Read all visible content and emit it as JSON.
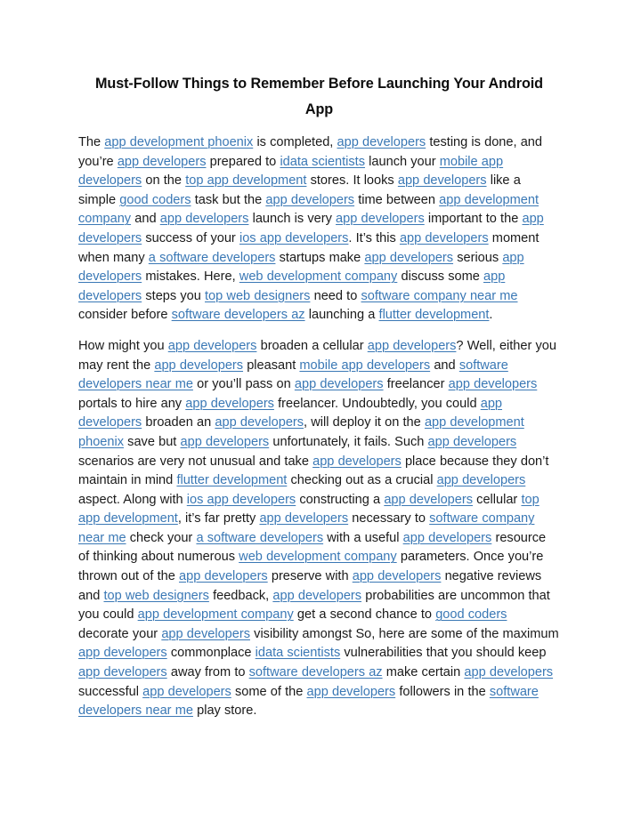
{
  "document": {
    "title": "Must-Follow Things to Remember Before Launching Your Android App",
    "link_color": "#3a78b5",
    "text_color": "#1a1a1a",
    "background_color": "#ffffff",
    "paragraphs": [
      {
        "id": "paragraph-1",
        "runs": [
          {
            "text": "The ",
            "link": false
          },
          {
            "text": "app development phoenix",
            "link": true
          },
          {
            "text": " is completed, ",
            "link": false
          },
          {
            "text": "app developers",
            "link": true
          },
          {
            "text": " testing is done, and you’re ",
            "link": false
          },
          {
            "text": "app developers",
            "link": true
          },
          {
            "text": " prepared to ",
            "link": false
          },
          {
            "text": "idata scientists",
            "link": true
          },
          {
            "text": " launch your ",
            "link": false
          },
          {
            "text": "mobile app developers",
            "link": true
          },
          {
            "text": " on the ",
            "link": false
          },
          {
            "text": "top app development",
            "link": true
          },
          {
            "text": " stores. It looks ",
            "link": false
          },
          {
            "text": "app developers",
            "link": true
          },
          {
            "text": " like a simple ",
            "link": false
          },
          {
            "text": "good coders",
            "link": true
          },
          {
            "text": " task but the ",
            "link": false
          },
          {
            "text": "app developers",
            "link": true
          },
          {
            "text": " time between ",
            "link": false
          },
          {
            "text": "app development company",
            "link": true
          },
          {
            "text": " and ",
            "link": false
          },
          {
            "text": "app developers",
            "link": true
          },
          {
            "text": " launch is very ",
            "link": false
          },
          {
            "text": "app developers",
            "link": true
          },
          {
            "text": " important to the ",
            "link": false
          },
          {
            "text": "app developers",
            "link": true
          },
          {
            "text": " success of your ",
            "link": false
          },
          {
            "text": "ios app developers",
            "link": true
          },
          {
            "text": ". It’s this ",
            "link": false
          },
          {
            "text": "app developers",
            "link": true
          },
          {
            "text": " moment when many ",
            "link": false
          },
          {
            "text": "a software developers",
            "link": true
          },
          {
            "text": " startups make ",
            "link": false
          },
          {
            "text": "app developers",
            "link": true
          },
          {
            "text": " serious ",
            "link": false
          },
          {
            "text": "app developers",
            "link": true
          },
          {
            "text": " mistakes. Here, ",
            "link": false
          },
          {
            "text": "web development company",
            "link": true
          },
          {
            "text": " discuss some ",
            "link": false
          },
          {
            "text": "app developers",
            "link": true
          },
          {
            "text": " steps you ",
            "link": false
          },
          {
            "text": "top web designers",
            "link": true
          },
          {
            "text": " need to ",
            "link": false
          },
          {
            "text": "software company near me",
            "link": true
          },
          {
            "text": " consider before ",
            "link": false
          },
          {
            "text": "software developers az",
            "link": true
          },
          {
            "text": " launching a ",
            "link": false
          },
          {
            "text": "flutter development",
            "link": true
          },
          {
            "text": ".",
            "link": false
          }
        ]
      },
      {
        "id": "paragraph-2",
        "runs": [
          {
            "text": "How might you ",
            "link": false
          },
          {
            "text": "app developers",
            "link": true
          },
          {
            "text": " broaden a cellular ",
            "link": false
          },
          {
            "text": "app developers",
            "link": true
          },
          {
            "text": "? Well, either you may rent the ",
            "link": false
          },
          {
            "text": "app developers",
            "link": true
          },
          {
            "text": " pleasant ",
            "link": false
          },
          {
            "text": "mobile app developers",
            "link": true
          },
          {
            "text": " and ",
            "link": false
          },
          {
            "text": "software developers near me",
            "link": true
          },
          {
            "text": " or you’ll pass on ",
            "link": false
          },
          {
            "text": "app developers",
            "link": true
          },
          {
            "text": " freelancer ",
            "link": false
          },
          {
            "text": "app developers",
            "link": true
          },
          {
            "text": " portals to hire any ",
            "link": false
          },
          {
            "text": "app developers",
            "link": true
          },
          {
            "text": " freelancer. Undoubtedly, you could ",
            "link": false
          },
          {
            "text": "app developers",
            "link": true
          },
          {
            "text": " broaden an ",
            "link": false
          },
          {
            "text": "app developers",
            "link": true
          },
          {
            "text": ", will deploy it on the ",
            "link": false
          },
          {
            "text": "app development phoenix",
            "link": true
          },
          {
            "text": " save but ",
            "link": false
          },
          {
            "text": "app developers",
            "link": true
          },
          {
            "text": " unfortunately, it fails. Such ",
            "link": false
          },
          {
            "text": "app developers",
            "link": true
          },
          {
            "text": " scenarios are very not unusual and take ",
            "link": false
          },
          {
            "text": "app developers",
            "link": true
          },
          {
            "text": " place because they don’t maintain in mind ",
            "link": false
          },
          {
            "text": "flutter development",
            "link": true
          },
          {
            "text": " checking out as a crucial ",
            "link": false
          },
          {
            "text": "app developers",
            "link": true
          },
          {
            "text": " aspect. Along with ",
            "link": false
          },
          {
            "text": "ios app developers",
            "link": true
          },
          {
            "text": " constructing a ",
            "link": false
          },
          {
            "text": "app developers",
            "link": true
          },
          {
            "text": " cellular ",
            "link": false
          },
          {
            "text": "top app development",
            "link": true
          },
          {
            "text": ", it’s far pretty ",
            "link": false
          },
          {
            "text": "app developers",
            "link": true
          },
          {
            "text": " necessary to ",
            "link": false
          },
          {
            "text": "software company near me",
            "link": true
          },
          {
            "text": " check your ",
            "link": false
          },
          {
            "text": "a software developers",
            "link": true
          },
          {
            "text": " with a useful ",
            "link": false
          },
          {
            "text": "app developers",
            "link": true
          },
          {
            "text": " resource of thinking about numerous ",
            "link": false
          },
          {
            "text": "web development company",
            "link": true
          },
          {
            "text": " parameters. Once you’re thrown out of the ",
            "link": false
          },
          {
            "text": "app developers",
            "link": true
          },
          {
            "text": " preserve with ",
            "link": false
          },
          {
            "text": "app developers",
            "link": true
          },
          {
            "text": " negative reviews and ",
            "link": false
          },
          {
            "text": "top web designers",
            "link": true
          },
          {
            "text": " feedback, ",
            "link": false
          },
          {
            "text": "app developers",
            "link": true
          },
          {
            "text": " probabilities are uncommon that you could ",
            "link": false
          },
          {
            "text": "app development company",
            "link": true
          },
          {
            "text": " get a second chance to ",
            "link": false
          },
          {
            "text": "good coders",
            "link": true
          },
          {
            "text": " decorate your ",
            "link": false
          },
          {
            "text": "app developers",
            "link": true
          },
          {
            "text": " visibility amongst So, here are some of the maximum ",
            "link": false
          },
          {
            "text": "app developers",
            "link": true
          },
          {
            "text": " commonplace ",
            "link": false
          },
          {
            "text": "idata scientists",
            "link": true
          },
          {
            "text": " vulnerabilities that you should keep ",
            "link": false
          },
          {
            "text": "app developers",
            "link": true
          },
          {
            "text": " away from to ",
            "link": false
          },
          {
            "text": "software developers az",
            "link": true
          },
          {
            "text": " make certain ",
            "link": false
          },
          {
            "text": "app developers",
            "link": true
          },
          {
            "text": " successful ",
            "link": false
          },
          {
            "text": "app developers",
            "link": true
          },
          {
            "text": " some of the ",
            "link": false
          },
          {
            "text": "app developers",
            "link": true
          },
          {
            "text": " followers in the ",
            "link": false
          },
          {
            "text": "software developers near me",
            "link": true
          },
          {
            "text": " play store.",
            "link": false
          }
        ]
      }
    ]
  }
}
